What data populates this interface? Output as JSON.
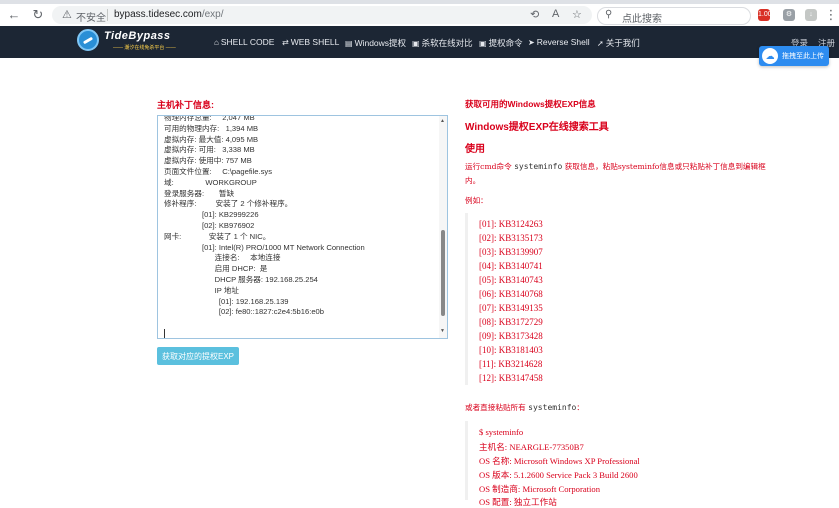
{
  "browser": {
    "insecure_label": "不安全",
    "url_host": "bypass.tidesec.com",
    "url_path": "/exp/",
    "search_placeholder": "点此搜索",
    "ext_badge": "1.00"
  },
  "site": {
    "logo_text": "TideBypass",
    "logo_sub": "—— 潮汐在线免杀平台 ——",
    "nav": [
      {
        "label": "SHELL CODE",
        "icon": "home-icon",
        "glyph": "⌂"
      },
      {
        "label": "WEB SHELL",
        "icon": "arrows-icon",
        "glyph": "⇄"
      },
      {
        "label": "Windows提权",
        "icon": "document-icon",
        "glyph": "▤"
      },
      {
        "label": "杀软在线对比",
        "icon": "monitor-icon",
        "glyph": "▣"
      },
      {
        "label": "提权命令",
        "icon": "terminal-icon",
        "glyph": "▣"
      },
      {
        "label": "Reverse Shell",
        "icon": "shell-icon",
        "glyph": "➤"
      },
      {
        "label": "关于我们",
        "icon": "send-icon",
        "glyph": "➚"
      }
    ],
    "login": "登录",
    "register": "注册",
    "upload_label": "拖拽至此上传"
  },
  "left": {
    "title": "主机补丁信息:",
    "textarea_text": "物理内存总量:     2,047 MB\n可用的物理内存:   1,394 MB\n虚拟内存: 最大值: 4,095 MB\n虚拟内存: 可用:   3,338 MB\n虚拟内存: 使用中: 757 MB\n页面文件位置:     C:\\pagefile.sys\n域:               WORKGROUP\n登录服务器:       暂缺\n修补程序:         安装了 2 个修补程序。\n                  [01]: KB2999226\n                  [02]: KB976902\n网卡:             安装了 1 个 NIC。\n                  [01]: Intel(R) PRO/1000 MT Network Connection\n                        连接名:     本地连接\n                        启用 DHCP:  是\n                        DHCP 服务器: 192.168.25.254\n                        IP 地址\n                          [01]: 192.168.25.139\n                          [02]: fe80::1827:c2e4:5b16:e0b",
    "button": "获取对应的提权EXP"
  },
  "right": {
    "h1": "获取可用的Windows提权EXP信息",
    "h2": "Windows提权EXP在线搜索工具",
    "h3": "使用",
    "desc_pre": "运行cmd命令 ",
    "desc_cmd": "systeminfo",
    "desc_post": " 获取信息，粘贴systeminfo信息或只粘贴补丁信息到编辑框内。",
    "example": "例如：",
    "kb_list": [
      "[01]: KB3124263",
      "[02]: KB3135173",
      "[03]: KB3139907",
      "[04]: KB3140741",
      "[05]: KB3140743",
      "[06]: KB3140768",
      "[07]: KB3149135",
      "[08]: KB3172729",
      "[09]: KB3173428",
      "[10]: KB3181403",
      "[11]: KB3214628",
      "[12]: KB3147458"
    ],
    "or_pre": "或者直接粘贴所有 ",
    "or_cmd": "systeminfo",
    "or_post": "：",
    "sys_lines": [
      "$ systeminfo",
      "主机名: NEARGLE-77350B7",
      "OS 名称: Microsoft Windows XP Professional",
      "OS 版本: 5.1.2600 Service Pack 3 Build 2600",
      "OS 制造商: Microsoft Corporation",
      "OS 配置: 独立工作站"
    ]
  }
}
